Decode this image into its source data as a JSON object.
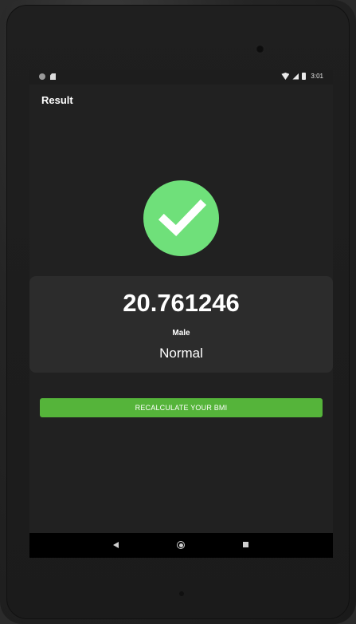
{
  "status_bar": {
    "time": "3:01",
    "icons": [
      "notification-dot-icon",
      "sd-card-icon",
      "wifi-icon",
      "signal-icon",
      "battery-icon"
    ]
  },
  "app_bar": {
    "title": "Result"
  },
  "result": {
    "status_icon": "check-circle-icon",
    "bmi_value": "20.761246",
    "gender": "Male",
    "category": "Normal"
  },
  "actions": {
    "recalculate_label": "RECALCULATE YOUR BMI"
  },
  "nav_bar": {
    "icons": [
      "back-icon",
      "home-icon",
      "recent-apps-icon"
    ]
  },
  "colors": {
    "accent_green": "#55b43a",
    "check_green": "#6fe07a",
    "background": "#212121",
    "card": "#2c2c2c"
  }
}
